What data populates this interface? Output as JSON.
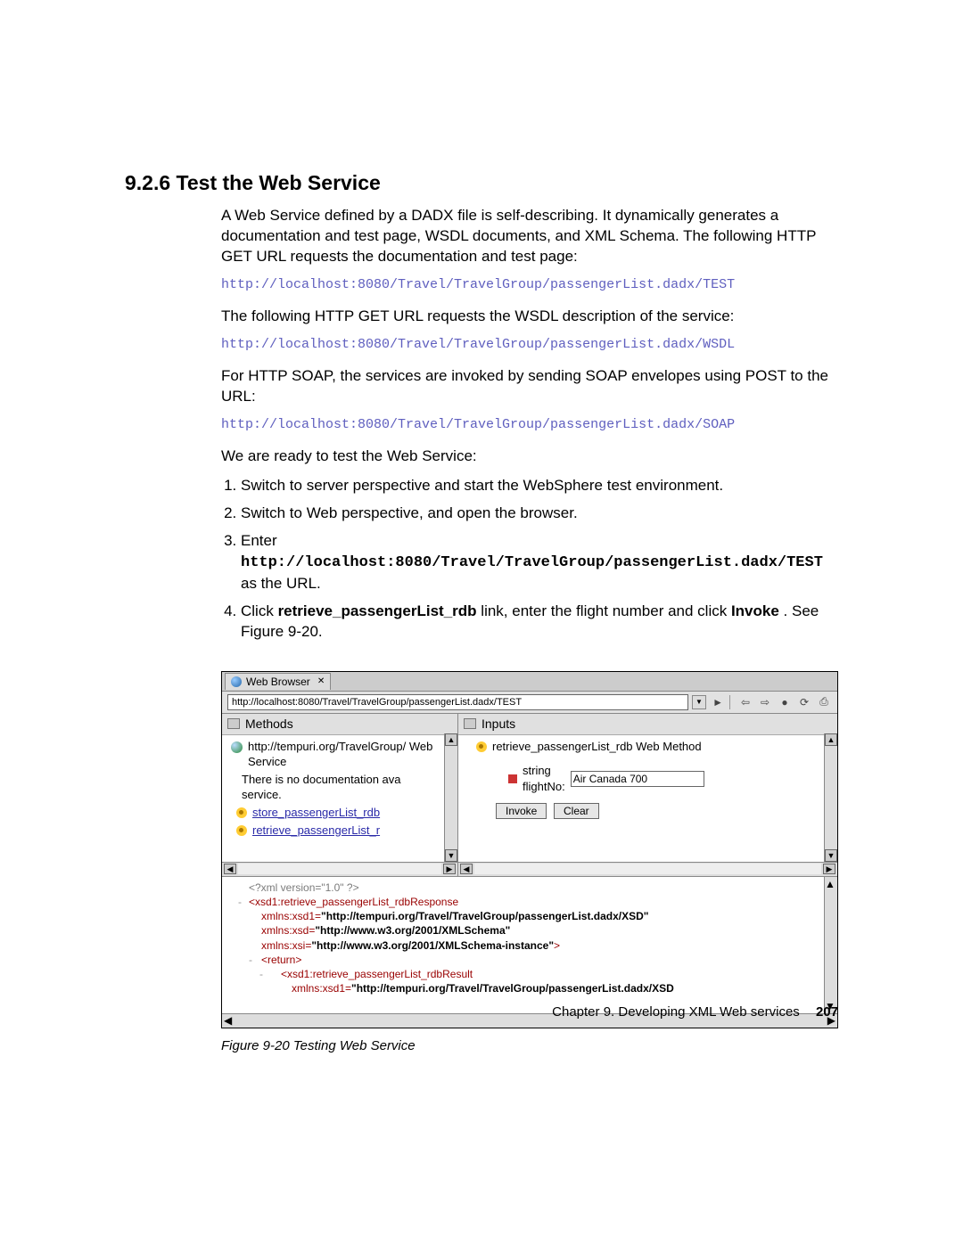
{
  "heading": "9.2.6  Test the Web Service",
  "para1": "A Web Service defined by a DADX file is self-describing. It dynamically generates a documentation and test page, WSDL documents, and XML Schema. The following HTTP GET URL requests the documentation and test page:",
  "url1": "http://localhost:8080/Travel/TravelGroup/passengerList.dadx/TEST",
  "para2": "The following HTTP GET URL requests the WSDL description of the service:",
  "url2": "http://localhost:8080/Travel/TravelGroup/passengerList.dadx/WSDL",
  "para3": "For HTTP SOAP, the services are invoked by sending SOAP envelopes using POST to the URL:",
  "url3": "http://localhost:8080/Travel/TravelGroup/passengerList.dadx/SOAP",
  "para4": "We are ready to test the Web Service:",
  "steps": {
    "s1": "Switch to server perspective and start the WebSphere test environment.",
    "s2": "Switch to Web perspective, and open the browser.",
    "s3_pre": "Enter ",
    "s3_code": "http://localhost:8080/Travel/TravelGroup/passengerList.dadx/TEST",
    "s3_post": " as the URL.",
    "s4_pre": "Click ",
    "s4_bold1": "retrieve_passengerList_rdb",
    "s4_mid": " link, enter the flight number and click ",
    "s4_bold2": "Invoke",
    "s4_post": ". See Figure 9-20."
  },
  "browser": {
    "tab_label": "Web Browser",
    "tab_close": "✕",
    "url_value": "http://localhost:8080/Travel/TravelGroup/passengerList.dadx/TEST",
    "buttons": {
      "go": "►",
      "back": "⇦",
      "fwd": "⇨",
      "stop": "●",
      "refresh": "⟳",
      "print": "⎙",
      "drop": "▼"
    },
    "methods_title": "Methods",
    "methods_ws": "http://tempuri.org/TravelGroup/ Web Service",
    "methods_doc": "There is no documentation ava service.",
    "method1": "store_passengerList_rdb",
    "method2": "retrieve_passengerList_r",
    "inputs_title": "Inputs",
    "input_method": "retrieve_passengerList_rdb Web Method",
    "param_type": "string",
    "param_name": "flightNo:",
    "param_value": "Air Canada 700",
    "btn_invoke": "Invoke",
    "btn_clear": "Clear"
  },
  "xml": {
    "decl": "<?xml version=\"1.0\" ?>",
    "l1a": "<xsd1:retrieve_passengerList_rdbResponse",
    "l2_attr": "xmlns:xsd1=",
    "l2_val": "\"http://tempuri.org/Travel/TravelGroup/passengerList.dadx/XSD\"",
    "l3_attr": "xmlns:xsd=",
    "l3_val": "\"http://www.w3.org/2001/XMLSchema\"",
    "l4_attr": "xmlns:xsi=",
    "l4_val": "\"http://www.w3.org/2001/XMLSchema-instance\"",
    "l4_close": ">",
    "l5": "<return>",
    "l6": "<xsd1:retrieve_passengerList_rdbResult",
    "l7_attr": "xmlns:xsd1=",
    "l7_val": "\"http://tempuri.org/Travel/TravelGroup/passengerList.dadx/XSD"
  },
  "fig_caption": "Figure 9-20   Testing Web Service",
  "footer_chapter": "Chapter 9. Developing XML Web services",
  "footer_page": "207"
}
